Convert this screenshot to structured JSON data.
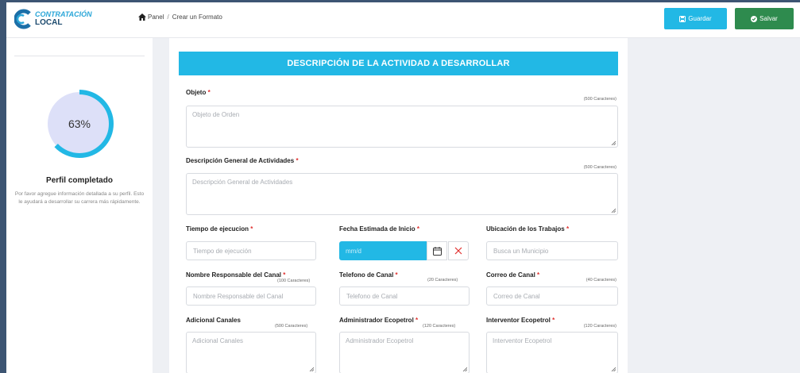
{
  "header": {
    "logo_top": "CONTRATACIÓN",
    "logo_bottom": "LOCAL",
    "breadcrumb": {
      "home": "Panel",
      "separator": "/",
      "current": "Crear un Formato"
    },
    "btn_guardar": "Guardar",
    "btn_salvar": "Salvar",
    "guardar_icon": "save-icon",
    "salvar_icon": "check-circle-icon"
  },
  "sidebar": {
    "progress_value": 0.63,
    "progress_text": "63%",
    "title": "Perfil completado",
    "description": "Por favor agregue información detallada a su perfil. Esto le ayudará a desarrollar su carrera más rápidamente."
  },
  "form": {
    "section_title": "DESCRIPCIÓN DE LA ACTIVIDAD A DESARROLLAR",
    "objeto": {
      "label": "Objeto",
      "hint": "(500 Caracteres)",
      "placeholder": "Objeto de Orden"
    },
    "descripcion": {
      "label": "Descripción General de Actividades",
      "hint": "(500 Caracteres)",
      "placeholder": "Descripción General de Actividades"
    },
    "tiempo": {
      "label": "Tiempo de ejecucion",
      "placeholder": "Tiempo de ejecución"
    },
    "fecha": {
      "label": "Fecha Estimada de Inicio",
      "placeholder": "mm/d",
      "calendar_icon": "calendar-icon",
      "clear_icon": "close-icon"
    },
    "ubicacion": {
      "label": "Ubicación de los Trabajos",
      "placeholder": "Busca un Municipio"
    },
    "responsable": {
      "label": "Nombre Responsable del Canal",
      "hint": "(100 Caracteres)",
      "placeholder": "Nombre Responsable del Canal"
    },
    "telefono": {
      "label": "Telefono de Canal",
      "hint": "(20 Caracteres)",
      "placeholder": "Telefono de Canal"
    },
    "correo": {
      "label": "Correo de Canal",
      "hint": "(40 Caracteres)",
      "placeholder": "Correo de Canal"
    },
    "adicional": {
      "label": "Adicional Canales",
      "hint": "(500 Caracteres)",
      "placeholder": "Adicional Canales"
    },
    "administrador": {
      "label": "Administrador Ecopetrol",
      "hint": "(120 Caracteres)",
      "placeholder": "Administrador Ecopetrol"
    },
    "interventor": {
      "label": "Interventor Ecopetrol",
      "hint": "(120 Caracteres)",
      "placeholder": "Interventor Ecopetrol"
    },
    "required_mark": "*"
  },
  "colors": {
    "accent": "#22b8e5",
    "success": "#2e8b4e",
    "required": "#e0302e",
    "background": "#3d5573"
  }
}
